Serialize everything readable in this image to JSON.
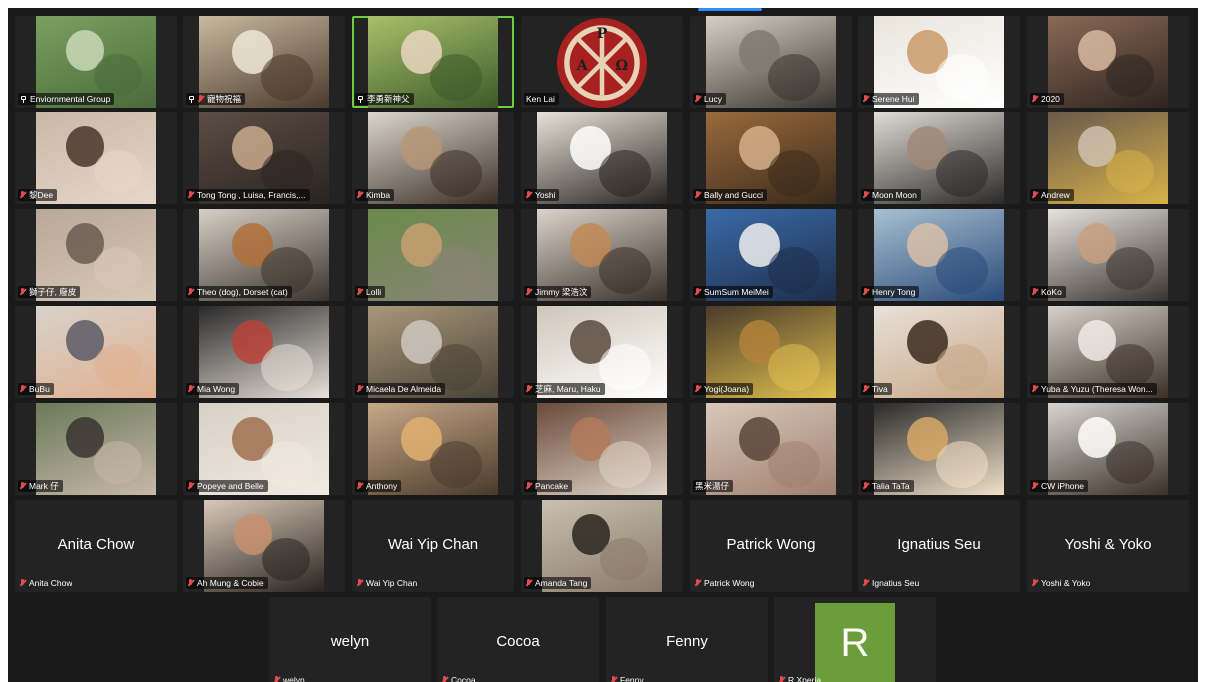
{
  "meeting": {
    "participants": [
      {
        "name": "Enviornmental Group",
        "label": "Enviornmental Group",
        "video": true,
        "pinned": true,
        "muted": false,
        "palette": [
          "#7aa060",
          "#c9d9b8",
          "#4b6b3a"
        ]
      },
      {
        "name": "寵物祝福",
        "label": "寵物祝福",
        "video": true,
        "pinned": true,
        "muted": true,
        "palette": [
          "#c8b9a0",
          "#efe8d8",
          "#4a3a2c"
        ]
      },
      {
        "name": "李勇新神父",
        "label": "李勇新神父",
        "video": true,
        "pinned": true,
        "muted": false,
        "active": true,
        "palette": [
          "#a8c06a",
          "#e9d7c0",
          "#3c5a2a"
        ]
      },
      {
        "name": "Ken Lai",
        "label": "Ken Lai",
        "video": true,
        "emblem": true,
        "muted": false,
        "palette": [
          "#1e1e1e",
          "#a82121",
          "#e7d2b5"
        ]
      },
      {
        "name": "Lucy",
        "label": "Lucy",
        "video": true,
        "muted": true,
        "palette": [
          "#d6d0c4",
          "#7f7a72",
          "#3a352f"
        ]
      },
      {
        "name": "Serene Hui",
        "label": "Serene Hui",
        "video": true,
        "muted": true,
        "palette": [
          "#e9e4dc",
          "#c99a6a",
          "#ffffff"
        ]
      },
      {
        "name": "2020",
        "label": "2020",
        "video": true,
        "muted": true,
        "palette": [
          "#8a6a56",
          "#d8b8a0",
          "#2e2420"
        ]
      },
      {
        "name": "Dee",
        "label": "黎Dee",
        "video": true,
        "muted": true,
        "palette": [
          "#c9b8a8",
          "#4a352c",
          "#e6d7c8"
        ]
      },
      {
        "name": "Tong Tong , Luisa, Francis,...",
        "label": "Tong Tong , Luisa, Francis,...",
        "video": true,
        "muted": true,
        "palette": [
          "#5b4d44",
          "#caa98c",
          "#2b2420"
        ]
      },
      {
        "name": "Kimba",
        "label": "Kimba",
        "video": true,
        "muted": true,
        "palette": [
          "#dcd6cc",
          "#b59677",
          "#3b3028"
        ]
      },
      {
        "name": "Yoshi",
        "label": "Yoshi",
        "video": true,
        "muted": true,
        "palette": [
          "#e8e2da",
          "#ffffff",
          "#2a2420"
        ]
      },
      {
        "name": "Bally and Gucci",
        "label": "Bally and Gucci",
        "video": true,
        "muted": true,
        "palette": [
          "#9a6a3c",
          "#d6b08a",
          "#3a2a1c"
        ]
      },
      {
        "name": "Moon Moon",
        "label": "Moon Moon",
        "video": true,
        "muted": true,
        "palette": [
          "#e0dcd6",
          "#a08a78",
          "#2b2a28"
        ]
      },
      {
        "name": "Andrew",
        "label": "Andrew",
        "video": true,
        "muted": true,
        "palette": [
          "#6a5a4c",
          "#cfc2b0",
          "#d8b24a"
        ]
      },
      {
        "name": "獅子仔, 廢皮",
        "label": "獅子仔, 廢皮",
        "video": true,
        "muted": true,
        "palette": [
          "#b8a898",
          "#6a5a50",
          "#d8c8b8"
        ]
      },
      {
        "name": "Theo (dog), Dorset (cat)",
        "label": "Theo (dog), Dorset (cat)",
        "video": true,
        "muted": true,
        "palette": [
          "#d6cfc6",
          "#b0703a",
          "#3c342c"
        ]
      },
      {
        "name": "Lolli",
        "label": "Lolli",
        "video": true,
        "muted": true,
        "palette": [
          "#6a8a4a",
          "#c8a070",
          "#8a8478"
        ]
      },
      {
        "name": "Jimmy 梁浩汶",
        "label": "Jimmy 梁浩汶",
        "video": true,
        "muted": true,
        "palette": [
          "#dcd4ca",
          "#c08a56",
          "#3a302a"
        ]
      },
      {
        "name": "SumSum MeiMei",
        "label": "SumSum MeiMei",
        "video": true,
        "muted": true,
        "palette": [
          "#3a6aa8",
          "#f0f0f0",
          "#1e2e4a"
        ]
      },
      {
        "name": "Henry Tong",
        "label": "Henry Tong",
        "video": true,
        "muted": true,
        "palette": [
          "#a8c0d0",
          "#d8c0a8",
          "#2a4a7a"
        ]
      },
      {
        "name": "KoKo",
        "label": "KoKo",
        "video": true,
        "muted": true,
        "palette": [
          "#e6e2dc",
          "#c8a080",
          "#3a3430"
        ]
      },
      {
        "name": "BuBu",
        "label": "BuBu",
        "video": true,
        "muted": true,
        "palette": [
          "#d8d2ca",
          "#5a5a66",
          "#e0b090"
        ]
      },
      {
        "name": "Mia Wong",
        "label": "Mia Wong",
        "video": true,
        "muted": true,
        "palette": [
          "#2a2a2a",
          "#b8423a",
          "#e8e0d8"
        ]
      },
      {
        "name": "Micaela De Almeida",
        "label": "Micaela De Almeida",
        "video": true,
        "muted": true,
        "palette": [
          "#a8987a",
          "#d0c8c0",
          "#4a4238"
        ]
      },
      {
        "name": "芝麻, Maru, Haku",
        "label": "芝麻, Maru, Haku",
        "video": true,
        "muted": true,
        "palette": [
          "#d0c6ba",
          "#5a4a40",
          "#ffffff"
        ]
      },
      {
        "name": "Yogi(Joana)",
        "label": "Yogi(Joana)",
        "video": true,
        "muted": true,
        "palette": [
          "#4a3a2a",
          "#b0823a",
          "#e0c050"
        ]
      },
      {
        "name": "Tiva",
        "label": "Tiva",
        "video": true,
        "muted": true,
        "palette": [
          "#e8e0d8",
          "#3a2a20",
          "#c8a888"
        ]
      },
      {
        "name": "Yuba & Yuzu (Theresa Won...",
        "label": "Yuba & Yuzu (Theresa Won...",
        "video": true,
        "muted": true,
        "palette": [
          "#d8d0c8",
          "#f0ece6",
          "#3a3028"
        ]
      },
      {
        "name": "Mark 仔",
        "label": "Mark 仔",
        "video": true,
        "muted": true,
        "palette": [
          "#6a7a5a",
          "#3a3430",
          "#c8b8a8"
        ]
      },
      {
        "name": "Popeye and Belle",
        "label": "Popeye and Belle",
        "video": true,
        "muted": true,
        "palette": [
          "#d8d0c4",
          "#a07050",
          "#f0eae0"
        ]
      },
      {
        "name": "Anthony",
        "label": "Anthony",
        "video": true,
        "muted": true,
        "palette": [
          "#c8a888",
          "#e0b070",
          "#4a3a2c"
        ]
      },
      {
        "name": "Pancake",
        "label": "Pancake",
        "video": true,
        "muted": true,
        "palette": [
          "#6a4a3a",
          "#b07a5a",
          "#e0d4c8"
        ]
      },
      {
        "name": "黑米湯仔",
        "label": "黑米湯仔",
        "video": true,
        "muted": false,
        "palette": [
          "#d8c8b8",
          "#5a4438",
          "#a08070"
        ]
      },
      {
        "name": "Talia TaTa",
        "label": "Talia TaTa",
        "video": true,
        "muted": true,
        "palette": [
          "#2a2a2a",
          "#d8a868",
          "#f0e0c8"
        ]
      },
      {
        "name": "CW iPhone",
        "label": "CW iPhone",
        "video": true,
        "muted": true,
        "palette": [
          "#d8d4d0",
          "#ffffff",
          "#3a3028"
        ]
      },
      {
        "name": "Anita Chow",
        "label": "Anita Chow",
        "video": false,
        "muted": true
      },
      {
        "name": "Ah Mung & Cobie",
        "label": "Ah Mung & Cobie",
        "video": true,
        "muted": true,
        "palette": [
          "#d8c8b8",
          "#c89070",
          "#2a2420"
        ]
      },
      {
        "name": "Wai Yip Chan",
        "label": "Wai Yip Chan",
        "video": false,
        "muted": true
      },
      {
        "name": "Amanda Tang",
        "label": "Amanda Tang",
        "video": true,
        "muted": true,
        "palette": [
          "#c8c0b0",
          "#2a2420",
          "#8a7a6a"
        ]
      },
      {
        "name": "Patrick Wong",
        "label": "Patrick Wong",
        "video": false,
        "muted": true
      },
      {
        "name": "Ignatius Seu",
        "label": "Ignatius Seu",
        "video": false,
        "muted": true
      },
      {
        "name": "Yoshi & Yoko",
        "label": "Yoshi & Yoko",
        "video": false,
        "muted": true
      },
      {
        "name": "welyn",
        "label": "welyn",
        "video": false,
        "muted": true
      },
      {
        "name": "Cocoa",
        "label": "Cocoa",
        "video": false,
        "muted": true
      },
      {
        "name": "Fenny",
        "label": "Fenny",
        "video": false,
        "muted": true
      },
      {
        "name": "R Xperia",
        "label": "R Xperia",
        "video": false,
        "avatar_letter": "R",
        "avatar_color": "#6c9d3b",
        "muted": true
      }
    ],
    "emblem": {
      "letters": [
        "P",
        "A",
        "Ω"
      ],
      "ring_color": "#a82121"
    }
  }
}
